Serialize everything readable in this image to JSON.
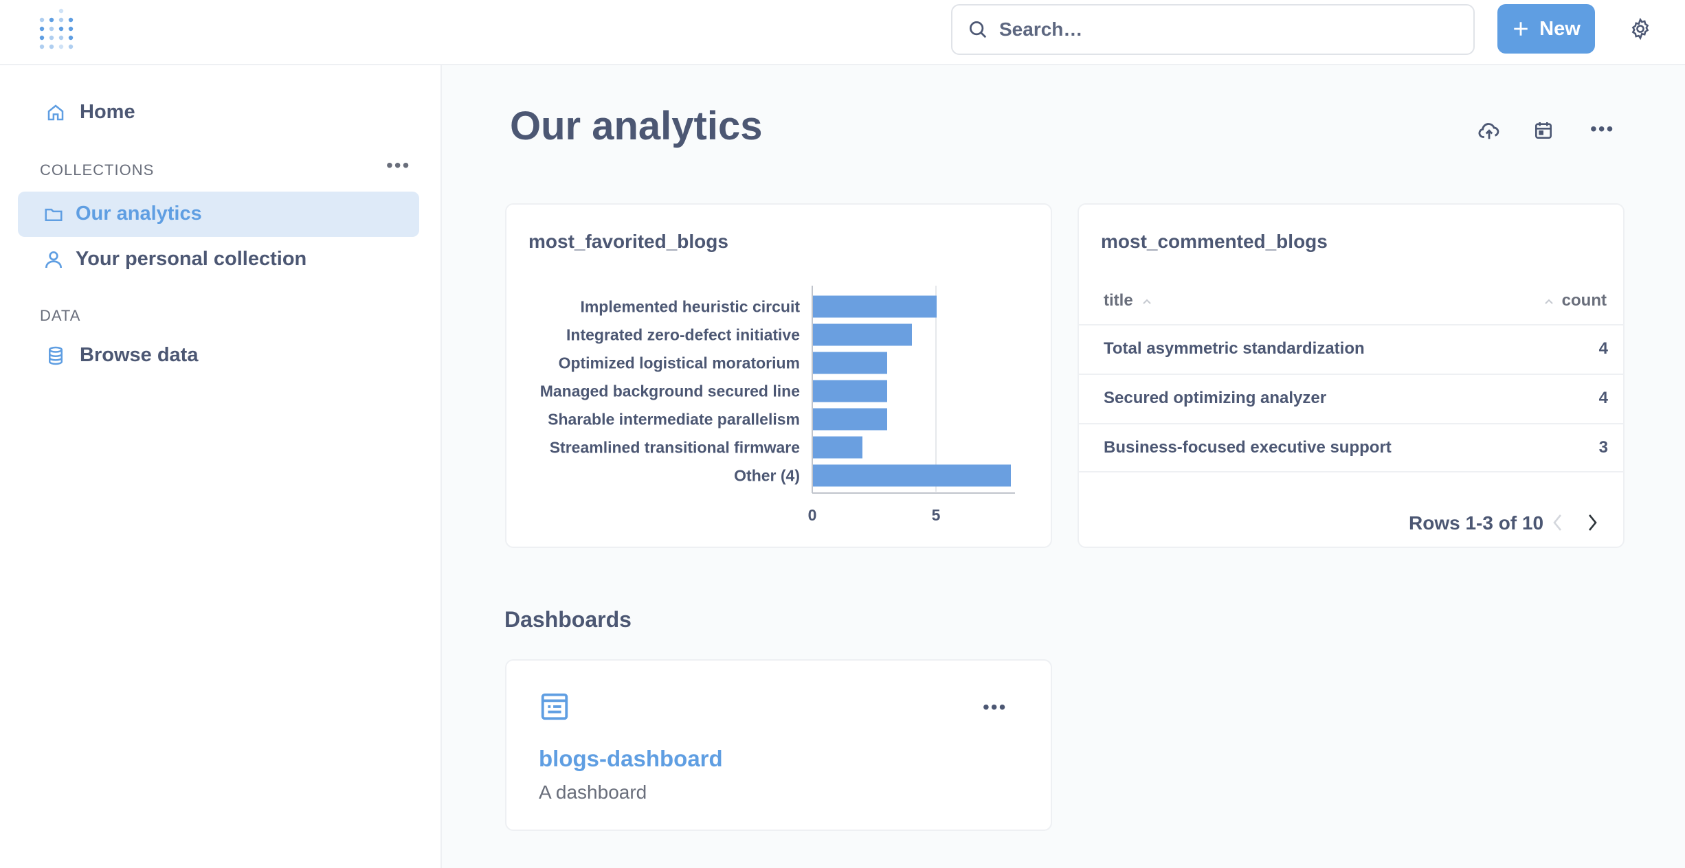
{
  "search": {
    "placeholder": "Search…"
  },
  "header": {
    "new_label": "New"
  },
  "sidebar": {
    "home_label": "Home",
    "collections_heading": "COLLECTIONS",
    "collections": [
      {
        "label": "Our analytics",
        "active": true
      },
      {
        "label": "Your personal collection",
        "active": false
      }
    ],
    "data_heading": "DATA",
    "browse_label": "Browse data"
  },
  "page": {
    "title": "Our analytics"
  },
  "cards": {
    "favorited": {
      "title": "most_favorited_blogs"
    },
    "commented": {
      "title": "most_commented_blogs",
      "columns": [
        "title",
        "count"
      ],
      "rows": [
        {
          "title": "Total asymmetric standardization",
          "count": "4"
        },
        {
          "title": "Secured optimizing analyzer",
          "count": "4"
        },
        {
          "title": "Business-focused executive support",
          "count": "3"
        }
      ],
      "pagination": "Rows 1-3 of 10"
    }
  },
  "dashboards": {
    "heading": "Dashboards",
    "items": [
      {
        "name": "blogs-dashboard",
        "description": "A dashboard"
      }
    ]
  },
  "colors": {
    "accent": "#5f9ee2",
    "bar": "#6a9fe0",
    "text": "#4c5773"
  },
  "chart_data": {
    "type": "bar",
    "orientation": "horizontal",
    "categories": [
      "Implemented heuristic circuit",
      "Integrated zero-defect initiative",
      "Optimized logistical moratorium",
      "Managed background secured line",
      "Sharable intermediate parallelism",
      "Streamlined transitional firmware",
      "Other (4)"
    ],
    "values": [
      5,
      4,
      3,
      3,
      3,
      2,
      8
    ],
    "xticks": [
      "0",
      "5"
    ],
    "xlim": [
      0,
      8.2
    ],
    "title": "most_favorited_blogs",
    "xlabel": "",
    "ylabel": ""
  }
}
